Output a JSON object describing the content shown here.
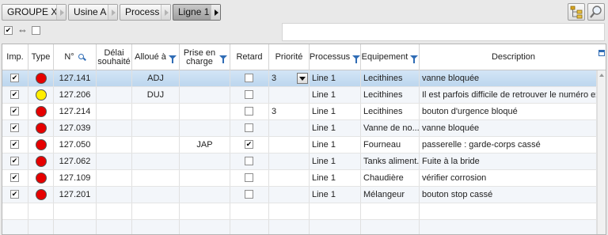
{
  "breadcrumb": [
    {
      "label": "GROUPE X",
      "active": false
    },
    {
      "label": "Usine A",
      "active": false
    },
    {
      "label": "Process",
      "active": false
    },
    {
      "label": "Ligne 1",
      "active": true
    }
  ],
  "toolbar": {
    "tree_icon": "tree-view-icon",
    "search_icon": "magnifier-icon",
    "select_all_checked": true,
    "swap_glyph": "⇔",
    "second_checked": false
  },
  "columns": [
    {
      "key": "imp",
      "label": "Imp.",
      "filter": false
    },
    {
      "key": "type",
      "label": "Type",
      "filter": false
    },
    {
      "key": "num",
      "label": "N°",
      "filter": false,
      "search": true
    },
    {
      "key": "delai",
      "label": "Délai souhaité",
      "filter": false
    },
    {
      "key": "alloue",
      "label": "Alloué à",
      "filter": true
    },
    {
      "key": "prise",
      "label": "Prise en charge",
      "filter": true
    },
    {
      "key": "retard",
      "label": "Retard",
      "filter": false
    },
    {
      "key": "priorite",
      "label": "Priorité",
      "filter": false
    },
    {
      "key": "processus",
      "label": "Processus",
      "filter": true
    },
    {
      "key": "equipement",
      "label": "Equipement",
      "filter": true
    },
    {
      "key": "description",
      "label": "Description",
      "filter": false
    }
  ],
  "colors": {
    "red": "#e60000",
    "yellow": "#ffee00",
    "selected_row": "#c8ddf2"
  },
  "rows": [
    {
      "imp": true,
      "type": "red",
      "num": "127.141",
      "delai": "",
      "alloue": "ADJ",
      "prise": "",
      "retard": false,
      "priorite": "3",
      "priorite_dropdown": true,
      "processus": "Line 1",
      "equipement": "Lecithines",
      "description": "vanne bloquée",
      "selected": true
    },
    {
      "imp": true,
      "type": "yellow",
      "num": "127.206",
      "delai": "",
      "alloue": "DUJ",
      "prise": "",
      "retard": false,
      "priorite": "",
      "processus": "Line 1",
      "equipement": "Lecithines",
      "description": "Il est parfois difficile de retrouver le numéro exa"
    },
    {
      "imp": true,
      "type": "red",
      "num": "127.214",
      "delai": "",
      "alloue": "",
      "prise": "",
      "retard": false,
      "priorite": "3",
      "processus": "Line 1",
      "equipement": "Lecithines",
      "description": "bouton d'urgence bloqué"
    },
    {
      "imp": true,
      "type": "red",
      "num": "127.039",
      "delai": "",
      "alloue": "",
      "prise": "",
      "retard": false,
      "priorite": "",
      "processus": "Line 1",
      "equipement": "Vanne de no...",
      "description": "vanne bloquée"
    },
    {
      "imp": true,
      "type": "red",
      "num": "127.050",
      "delai": "",
      "alloue": "",
      "prise": "JAP",
      "retard": true,
      "priorite": "",
      "processus": "Line 1",
      "equipement": "Fourneau",
      "description": "passerelle : garde-corps cassé"
    },
    {
      "imp": true,
      "type": "red",
      "num": "127.062",
      "delai": "",
      "alloue": "",
      "prise": "",
      "retard": false,
      "priorite": "",
      "processus": "Line 1",
      "equipement": "Tanks aliment...",
      "description": "Fuite à la bride"
    },
    {
      "imp": true,
      "type": "red",
      "num": "127.109",
      "delai": "",
      "alloue": "",
      "prise": "",
      "retard": false,
      "priorite": "",
      "processus": "Line 1",
      "equipement": "Chaudière",
      "description": "vérifier corrosion"
    },
    {
      "imp": true,
      "type": "red",
      "num": "127.201",
      "delai": "",
      "alloue": "",
      "prise": "",
      "retard": false,
      "priorite": "",
      "processus": "Line 1",
      "equipement": "Mélangeur",
      "description": "bouton stop cassé"
    }
  ]
}
